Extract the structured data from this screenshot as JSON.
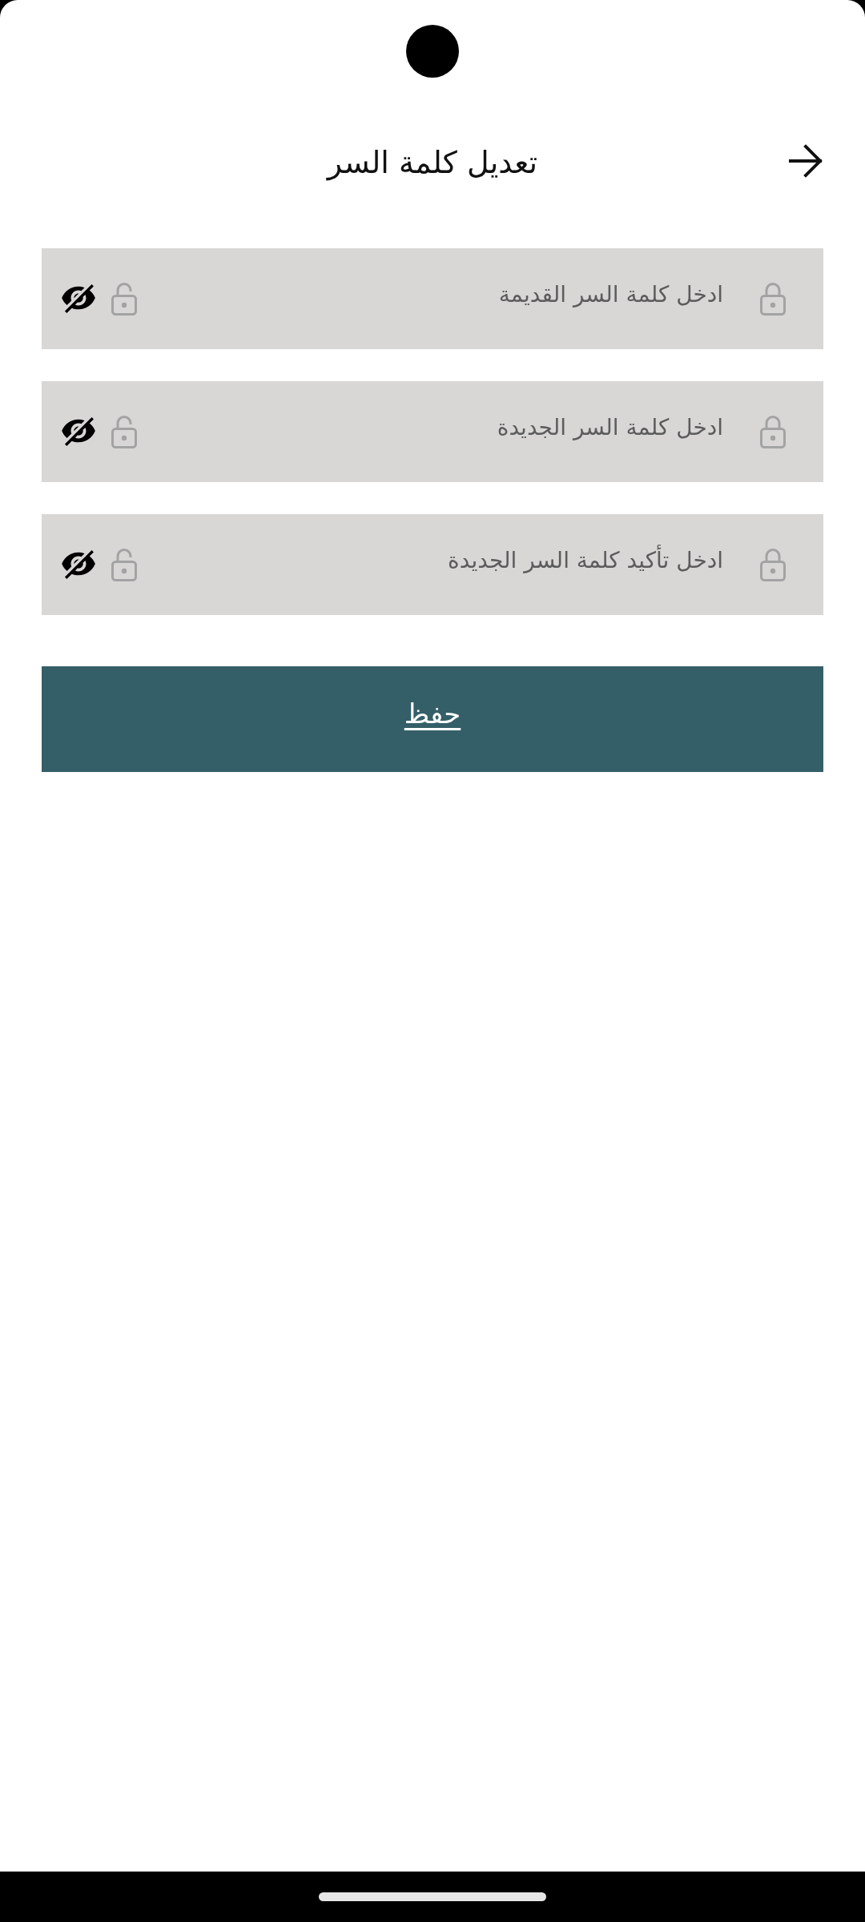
{
  "header": {
    "title": "تعديل كلمة السر"
  },
  "fields": [
    {
      "placeholder": "ادخل كلمة السر القديمة",
      "revealed": false
    },
    {
      "placeholder": "ادخل كلمة السر الجديدة",
      "revealed": false
    },
    {
      "placeholder": "ادخل تأكيد كلمة السر الجديدة",
      "revealed": false
    }
  ],
  "save_button": {
    "label": "حفظ"
  }
}
